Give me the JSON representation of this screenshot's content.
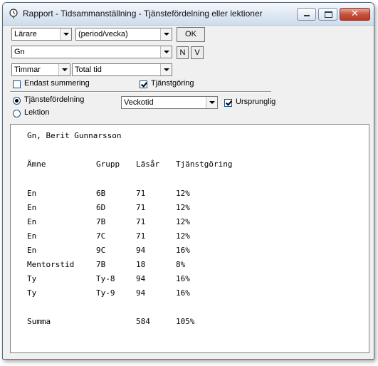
{
  "window": {
    "title": "Rapport - Tidsammanställning - Tjänstefördelning eller lektioner",
    "close_glyph": "✕"
  },
  "controls": {
    "entity_select": "Lärare",
    "period_select": "(period/vecka)",
    "ok_button": "OK",
    "person_select": "Gn",
    "n_button": "N",
    "v_button": "V",
    "unit_select": "Timmar",
    "total_select": "Total tid",
    "endast_summering_label": "Endast summering",
    "endast_summering_checked": false,
    "tjanstgoring_label": "Tjänstgöring",
    "tjanstgoring_checked": true,
    "radio_tjanstefordelning_label": "Tjänstefördelning",
    "radio_tjanstefordelning_selected": true,
    "radio_lektion_label": "Lektion",
    "radio_lektion_selected": false,
    "veckotid_select": "Veckotid",
    "ursprunglig_label": "Ursprunglig",
    "ursprunglig_checked": true
  },
  "report": {
    "person": "Gn, Berit Gunnarsson",
    "headers": [
      "Ämne",
      "Grupp",
      "Läsår",
      "Tjänstgöring"
    ],
    "rows": [
      [
        "En",
        "6B",
        "71",
        "12%"
      ],
      [
        "En",
        "6D",
        "71",
        "12%"
      ],
      [
        "En",
        "7B",
        "71",
        "12%"
      ],
      [
        "En",
        "7C",
        "71",
        "12%"
      ],
      [
        "En",
        "9C",
        "94",
        "16%"
      ],
      [
        "Mentorstid",
        "7B",
        "18",
        "8%"
      ],
      [
        "Ty",
        "Ty-8",
        "94",
        "16%"
      ],
      [
        "Ty",
        "Ty-9",
        "94",
        "16%"
      ]
    ],
    "summary_label": "Summa",
    "summary_lasar": "584",
    "summary_tjanstgoring": "105%"
  }
}
